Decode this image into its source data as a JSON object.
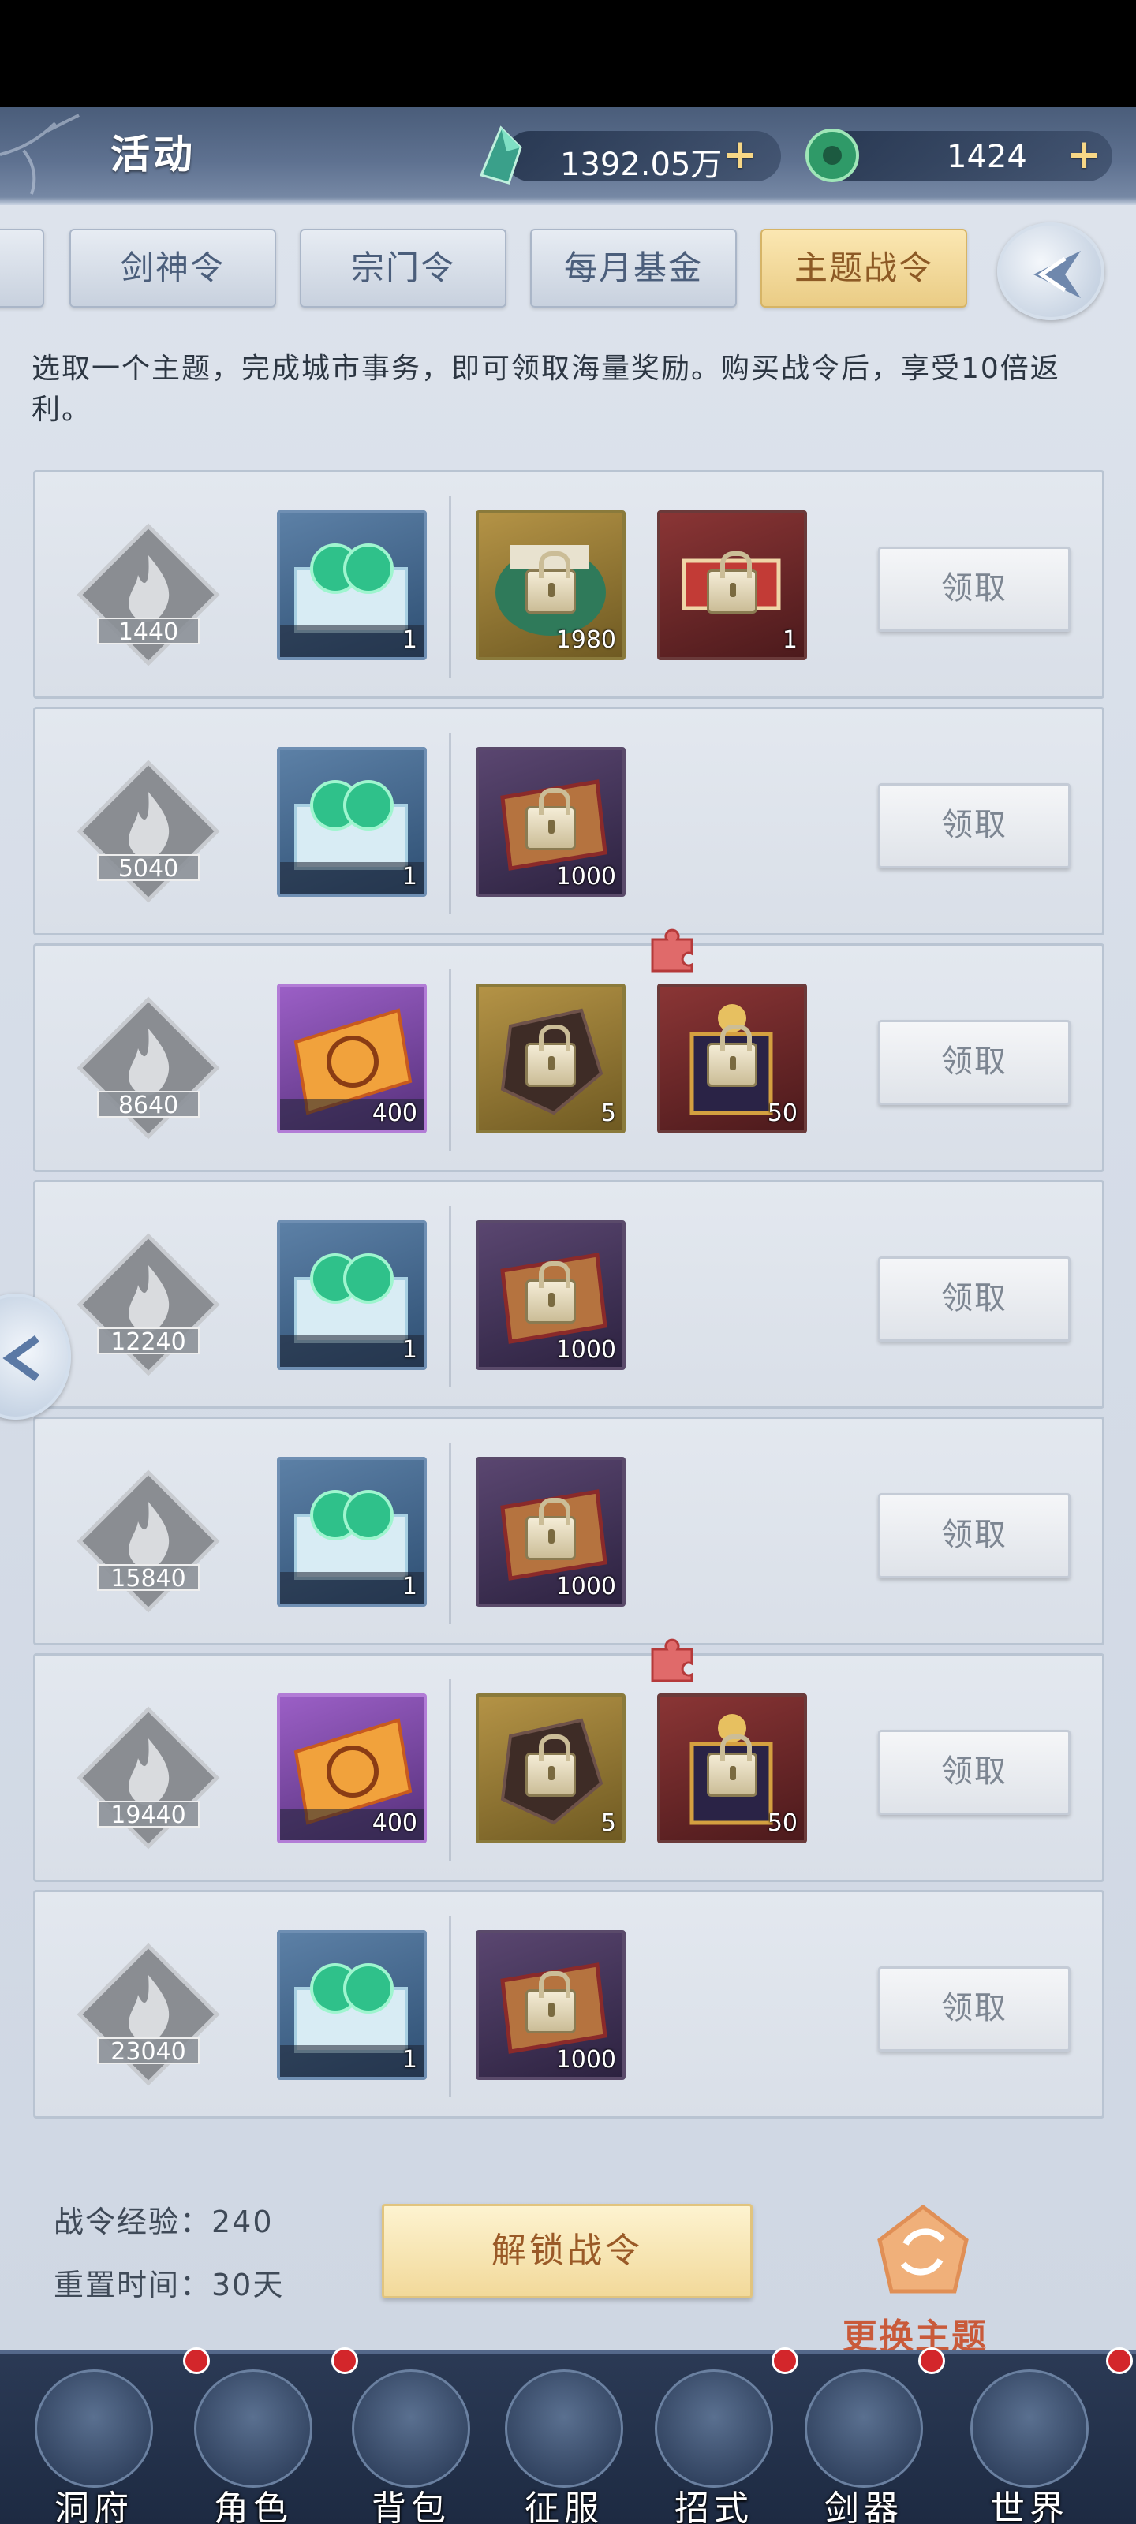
{
  "header": {
    "title": "活动",
    "currency_primary": {
      "value": "1392.05万",
      "icon": "jade-crystal-icon",
      "plus": "+"
    },
    "currency_secondary": {
      "value": "1424",
      "icon": "jade-ring-icon",
      "plus": "+"
    }
  },
  "tabs": [
    {
      "label": "剑神令"
    },
    {
      "label": "宗门令"
    },
    {
      "label": "每月基金"
    },
    {
      "label": "主题战令",
      "active": true
    }
  ],
  "description": "选取一个主题，完成城市事务，即可领取海量奖励。购买战令后，享受10倍返利。",
  "rows": [
    {
      "threshold": "1440",
      "items": [
        {
          "icon": "jade-beads-box-icon",
          "count": "1"
        },
        {
          "icon": "locked-dragon-chest-icon",
          "count": "1980"
        },
        {
          "icon": "locked-scroll-chest-icon",
          "count": "1"
        }
      ],
      "claim": "领取"
    },
    {
      "threshold": "5040",
      "items": [
        {
          "icon": "jade-beads-box-icon",
          "count": "1"
        },
        {
          "icon": "locked-red-packet-icon",
          "count": "1000"
        }
      ],
      "claim": "领取"
    },
    {
      "threshold": "8640",
      "items": [
        {
          "icon": "taiji-talisman-icon",
          "count": "400"
        },
        {
          "icon": "locked-ore-icon",
          "count": "5"
        },
        {
          "icon": "locked-crown-chest-icon",
          "count": "50"
        }
      ],
      "claim": "领取"
    },
    {
      "threshold": "12240",
      "items": [
        {
          "icon": "jade-beads-box-icon",
          "count": "1"
        },
        {
          "icon": "locked-red-packet-icon",
          "count": "1000"
        }
      ],
      "claim": "领取"
    },
    {
      "threshold": "15840",
      "items": [
        {
          "icon": "jade-beads-box-icon",
          "count": "1"
        },
        {
          "icon": "locked-red-packet-icon",
          "count": "1000"
        }
      ],
      "claim": "领取"
    },
    {
      "threshold": "19440",
      "items": [
        {
          "icon": "taiji-talisman-icon",
          "count": "400"
        },
        {
          "icon": "locked-ore-icon",
          "count": "5"
        },
        {
          "icon": "locked-crown-chest-icon",
          "count": "50"
        }
      ],
      "claim": "领取"
    },
    {
      "threshold": "23040",
      "items": [
        {
          "icon": "jade-beads-box-icon",
          "count": "1"
        },
        {
          "icon": "locked-red-packet-icon",
          "count": "1000"
        }
      ],
      "claim": "领取"
    }
  ],
  "footer": {
    "exp": "战令经验：240",
    "reset": "重置时间：30天",
    "unlock": "解锁战令",
    "switch_theme": "更换主题"
  },
  "nav": [
    {
      "label": "洞府",
      "icon": "cave-mansion-icon",
      "badge": true
    },
    {
      "label": "角色",
      "icon": "character-icon",
      "badge": true
    },
    {
      "label": "背包",
      "icon": "backpack-icon",
      "badge": false
    },
    {
      "label": "征服",
      "icon": "crossed-swords-icon",
      "badge": false
    },
    {
      "label": "招式",
      "icon": "skill-scroll-icon",
      "badge": true
    },
    {
      "label": "剑器",
      "icon": "sword-weapon-icon",
      "badge": true
    },
    {
      "label": "世界",
      "icon": "world-map-icon",
      "badge": true
    }
  ],
  "colors": {
    "accent_gold": "#eacc85",
    "claim_text": "#7d8692",
    "switch_text": "#c95a3a",
    "badge_red": "#d3262b"
  }
}
